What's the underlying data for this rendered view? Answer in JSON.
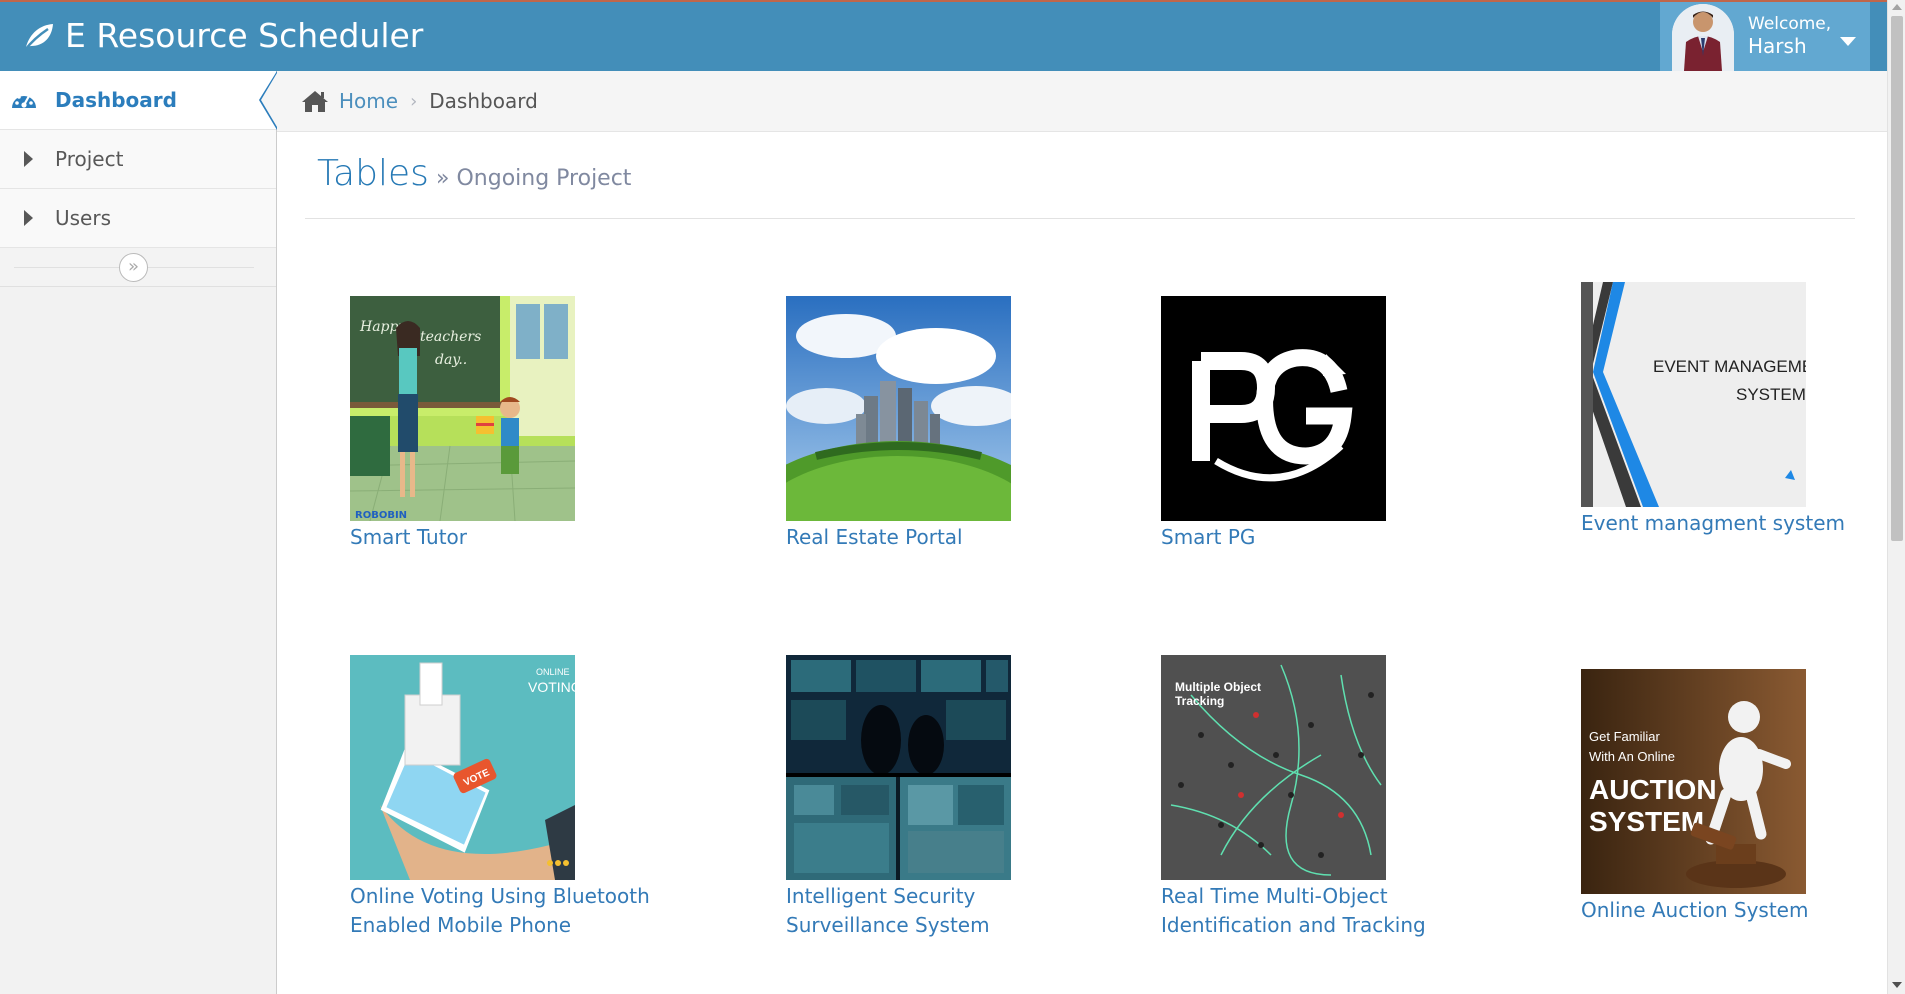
{
  "app": {
    "brand": "E Resource Scheduler",
    "welcome_line": "Welcome,",
    "user_name": "Harsh"
  },
  "sidebar": {
    "items": [
      {
        "label": "Dashboard",
        "icon": "tachometer-icon",
        "active": true
      },
      {
        "label": "Project",
        "icon": "caret-right-icon"
      },
      {
        "label": "Users",
        "icon": "caret-right-icon"
      }
    ],
    "collapse_icon": "double-angle-right-icon"
  },
  "breadcrumb": {
    "home": "Home",
    "separator": "›",
    "current": "Dashboard"
  },
  "page": {
    "title": "Tables",
    "subtitle_prefix": "»",
    "subtitle": "Ongoing Project"
  },
  "projects": [
    {
      "label": "Smart Tutor",
      "image": "teacher-classroom-illustration"
    },
    {
      "label": "Real Estate Portal",
      "image": "buildings-on-green-hill"
    },
    {
      "label": "Smart PG",
      "image": "pg-logo-black"
    },
    {
      "label": "Event managment system",
      "image": "event-management-slide",
      "image_text_1": "EVENT MANAGEMENT",
      "image_text_2": "SYSTEM"
    },
    {
      "label": "Online Voting Using Bluetooth Enabled Mobile Phone",
      "image": "online-voting-illustration",
      "image_text_1": "ONLINE",
      "image_text_2": "VOTING",
      "image_text_3": "VOTE"
    },
    {
      "label": "Intelligent Security Surveillance System",
      "image": "surveillance-monitors-photo"
    },
    {
      "label": "Real Time Multi-Object Identification and Tracking",
      "image": "crowd-tracking-aerial",
      "image_text_1": "Multiple Object",
      "image_text_2": "Tracking"
    },
    {
      "label": "Online Auction System",
      "image": "auction-gavel-figure",
      "image_text_1": "Get Familiar",
      "image_text_2": "With An Online",
      "image_text_3": "AUCTION",
      "image_text_4": "SYSTEM"
    }
  ],
  "colors": {
    "navbar": "#438eb9",
    "user_box": "#62a8d1",
    "link": "#337ab7",
    "active": "#2b7dbc"
  }
}
